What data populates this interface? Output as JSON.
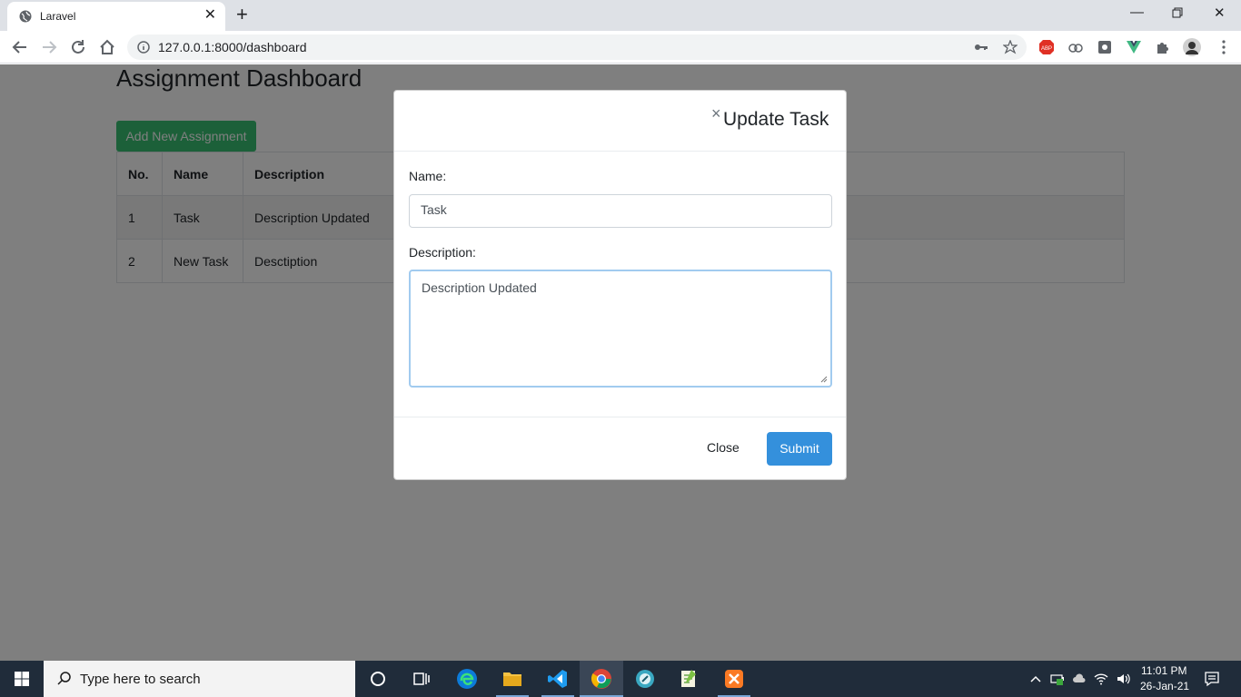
{
  "browser": {
    "tab_title": "Laravel",
    "url": "127.0.0.1:8000/dashboard"
  },
  "page": {
    "title": "Assignment Dashboard",
    "add_button": "Add New Assignment",
    "table": {
      "headers": [
        "No.",
        "Name",
        "Description"
      ],
      "rows": [
        [
          "1",
          "Task",
          "Description Updated"
        ],
        [
          "2",
          "New Task",
          "Desctiption"
        ]
      ]
    }
  },
  "modal": {
    "title": "Update Task",
    "close_x": "×",
    "name_label": "Name:",
    "name_value": "Task",
    "description_label": "Description:",
    "description_value": "Description Updated",
    "close_button": "Close",
    "submit_button": "Submit"
  },
  "taskbar": {
    "search_placeholder": "Type here to search",
    "time": "11:01 PM",
    "date": "26-Jan-21"
  },
  "colors": {
    "add_button": "#38c172",
    "submit_button": "#3490dc",
    "taskbar": "#202c3a"
  }
}
